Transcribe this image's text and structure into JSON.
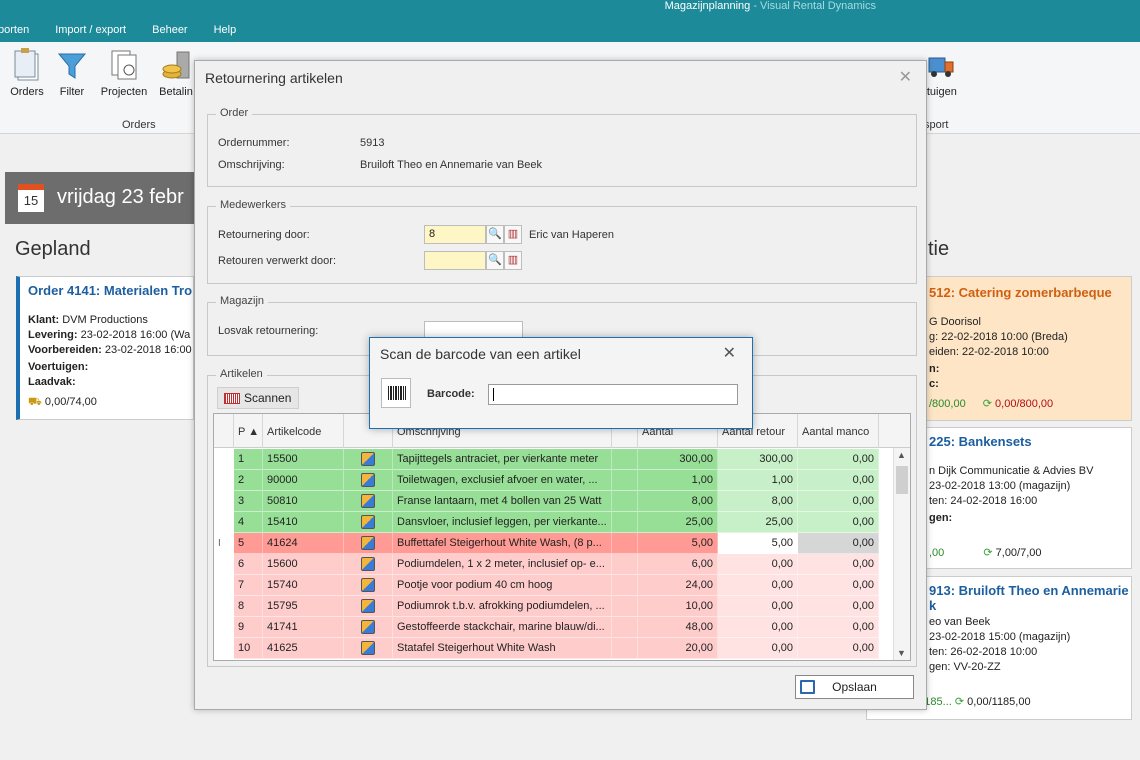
{
  "app": {
    "title": "Magazijnplanning",
    "subtitle": " - Visual Rental Dynamics",
    "menu": [
      "porten",
      "Import / export",
      "Beheer",
      "Help"
    ]
  },
  "ribbon": {
    "buttons": [
      "Orders",
      "Filter",
      "Projecten",
      "Betalin",
      "rtuigen"
    ],
    "groups": [
      "Orders",
      "sport"
    ]
  },
  "background": {
    "date": "vrijdag 23 febr",
    "date_num": "15",
    "gepland": "Gepland",
    "right_title": "tie",
    "card1": {
      "title": "Order 4141: Materialen Tro",
      "klant_lbl": "Klant:",
      "klant": "DVM Productions",
      "levering_lbl": "Levering:",
      "levering": "23-02-2018 16:00 (Wa",
      "voorbereiden_lbl": "Voorbereiden:",
      "voorbereiden": "23-02-2018 16:00",
      "voertuigen_lbl": "Voertuigen:",
      "laadvak_lbl": "Laadvak:",
      "amount": "0,00/74,00"
    },
    "card2": {
      "title": "512: Catering zomerbarbeque",
      "l1": "G Doorisol",
      "l2": "g: 22-02-2018 10:00 (Breda)",
      "l3": "eiden: 22-02-2018 10:00",
      "l4": "n:",
      "l5": "c:",
      "a1": "/800,00",
      "a2": "0,00/800,00"
    },
    "card3": {
      "title": "225: Bankensets",
      "l1": "n Dijk Communicatie & Advies BV",
      "l2": "23-02-2018 13:00 (magazijn)",
      "l3": "ten: 24-02-2018 16:00",
      "l4": "gen:",
      "a1": ",00",
      "a2": "7,00/7,00"
    },
    "card4": {
      "title": "913: Bruiloft Theo en Annemarie",
      "title2": "k",
      "l1": "eo van Beek",
      "l2": "23-02-2018 15:00 (magazijn)",
      "l3": "ten: 26-02-2018 10:00",
      "l4": "gen: VV-20-ZZ",
      "a1": "1185,00/1185...",
      "a2": "0,00/1185,00"
    }
  },
  "dialog": {
    "title": "Retournering artikelen",
    "order_legend": "Order",
    "ordernummer_lbl": "Ordernummer:",
    "ordernummer": "5913",
    "omschrijving_lbl": "Omschrijving:",
    "omschrijving": "Bruiloft Theo en Annemarie van Beek",
    "medewerkers_legend": "Medewerkers",
    "retour_door_lbl": "Retournering door:",
    "retour_door_value": "8",
    "retour_door_name": "Eric van Haperen",
    "verwerkt_lbl": "Retouren verwerkt door:",
    "magazijn_legend": "Magazijn",
    "losvak_lbl": "Losvak retournering:",
    "artikelen_legend": "Artikelen",
    "scan_btn": "Scannen",
    "save_btn": "Opslaan",
    "columns": [
      "P",
      "Artikelcode",
      "",
      "Omschrijving",
      "",
      "Aantal",
      "Aantal retour",
      "Aantal manco"
    ],
    "rows": [
      {
        "p": "1",
        "code": "15500",
        "desc": "Tapijttegels antraciet, per vierkante meter",
        "aantal": "300,00",
        "retour": "300,00",
        "manco": "0,00"
      },
      {
        "p": "2",
        "code": "90000",
        "desc": "Toiletwagen, exclusief afvoer en water, ...",
        "aantal": "1,00",
        "retour": "1,00",
        "manco": "0,00"
      },
      {
        "p": "3",
        "code": "50810",
        "desc": "Franse lantaarn, met 4 bollen van 25 Watt",
        "aantal": "8,00",
        "retour": "8,00",
        "manco": "0,00"
      },
      {
        "p": "4",
        "code": "15410",
        "desc": "Dansvloer, inclusief leggen, per vierkante...",
        "aantal": "25,00",
        "retour": "25,00",
        "manco": "0,00"
      },
      {
        "p": "5",
        "code": "41624",
        "desc": "Buffettafel Steigerhout White Wash, (8 p...",
        "aantal": "5,00",
        "retour": "5,00",
        "manco": "0,00"
      },
      {
        "p": "6",
        "code": "15600",
        "desc": "Podiumdelen, 1 x 2 meter, inclusief op- e...",
        "aantal": "6,00",
        "retour": "0,00",
        "manco": "0,00"
      },
      {
        "p": "7",
        "code": "15740",
        "desc": "Pootje voor podium 40 cm hoog",
        "aantal": "24,00",
        "retour": "0,00",
        "manco": "0,00"
      },
      {
        "p": "8",
        "code": "15795",
        "desc": "Podiumrok t.b.v. afrokking podiumdelen, ...",
        "aantal": "10,00",
        "retour": "0,00",
        "manco": "0,00"
      },
      {
        "p": "9",
        "code": "41741",
        "desc": "Gestoffeerde stackchair, marine blauw/di...",
        "aantal": "48,00",
        "retour": "0,00",
        "manco": "0,00"
      },
      {
        "p": "10",
        "code": "41625",
        "desc": "Statafel Steigerhout White Wash",
        "aantal": "20,00",
        "retour": "0,00",
        "manco": "0,00"
      }
    ]
  },
  "scan_dialog": {
    "title": "Scan de barcode van een artikel",
    "barcode_lbl": "Barcode:",
    "barcode_value": ""
  }
}
